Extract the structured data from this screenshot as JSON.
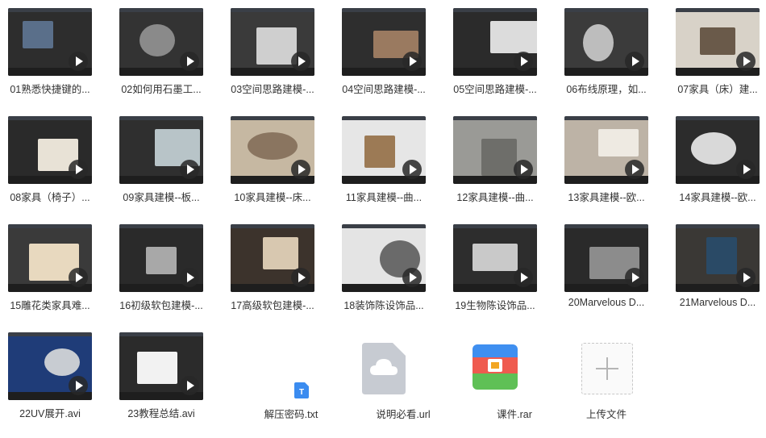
{
  "videos": [
    {
      "label": "01熟悉快捷键的...",
      "bg": "#2d2d2d",
      "accent": "#5a6f8a"
    },
    {
      "label": "02如何用石墨工...",
      "bg": "#333333",
      "accent": "#8a8a8a"
    },
    {
      "label": "03空间思路建模-...",
      "bg": "#3a3a3a",
      "accent": "#cfcfcf"
    },
    {
      "label": "04空间思路建模-...",
      "bg": "#2e2e2e",
      "accent": "#9a7a60"
    },
    {
      "label": "05空间思路建模-...",
      "bg": "#2b2b2b",
      "accent": "#dcdcdc"
    },
    {
      "label": "06布线原理，如...",
      "bg": "#3b3b3b",
      "accent": "#bdbdbd"
    },
    {
      "label": "07家具（床）建...",
      "bg": "#d8d2c8",
      "accent": "#6a5a4a"
    },
    {
      "label": "08家具（椅子）...",
      "bg": "#2a2a2a",
      "accent": "#e8e2d6"
    },
    {
      "label": "09家具建模--板...",
      "bg": "#2f2f2f",
      "accent": "#b8c4c8"
    },
    {
      "label": "10家具建模--床...",
      "bg": "#c6b8a2",
      "accent": "#8a7560"
    },
    {
      "label": "11家具建模--曲...",
      "bg": "#e6e6e6",
      "accent": "#9c7a55"
    },
    {
      "label": "12家具建模--曲...",
      "bg": "#9a9a96",
      "accent": "#6e6e6a"
    },
    {
      "label": "13家具建模--欧...",
      "bg": "#bdb3a6",
      "accent": "#eeeae2"
    },
    {
      "label": "14家具建模--欧...",
      "bg": "#2c2c2c",
      "accent": "#d9d9d9"
    },
    {
      "label": "15雕花类家具难...",
      "bg": "#3a3a3a",
      "accent": "#e8d9bf"
    },
    {
      "label": "16初级软包建模-...",
      "bg": "#2a2a2a",
      "accent": "#a8a8a8"
    },
    {
      "label": "17高级软包建模-...",
      "bg": "#3c332c",
      "accent": "#d8c8b0"
    },
    {
      "label": "18装饰陈设饰品...",
      "bg": "#e4e4e4",
      "accent": "#6a6a6a"
    },
    {
      "label": "19生物陈设饰品...",
      "bg": "#2d2d2d",
      "accent": "#c9c9c9"
    },
    {
      "label": "20Marvelous D...",
      "bg": "#2a2a2a",
      "accent": "#8c8c8c"
    },
    {
      "label": "21Marvelous D...",
      "bg": "#3a3835",
      "accent": "#2a4a66"
    },
    {
      "label": "22UV展开.avi",
      "bg": "#1f3c78",
      "accent": "#c8ccd2"
    },
    {
      "label": "23教程总结.avi",
      "bg": "#2b2b2b",
      "accent": "#f2f2f2"
    }
  ],
  "files": [
    {
      "label": "解压密码.txt",
      "icon": "txt-file-icon",
      "color": "#3b8cf0"
    },
    {
      "label": "说明必看.url",
      "icon": "cloud-link-icon",
      "color": "#c4c8cf"
    },
    {
      "label": "课件.rar",
      "icon": "rar-archive-icon",
      "color": "#f0a020"
    }
  ],
  "upload": {
    "label": "上传文件",
    "icon": "plus-icon"
  }
}
